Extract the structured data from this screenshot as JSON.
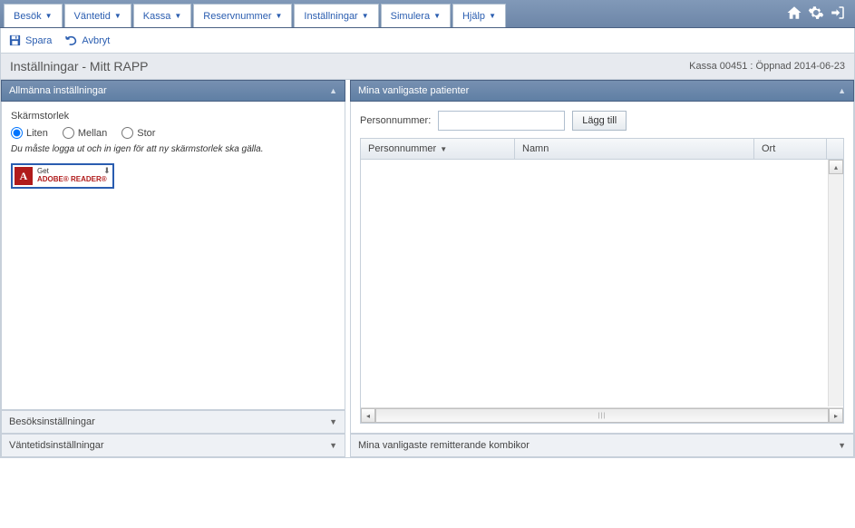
{
  "menu": [
    "Besök",
    "Väntetid",
    "Kassa",
    "Reservnummer",
    "Inställningar",
    "Simulera",
    "Hjälp"
  ],
  "toolbar": {
    "save_label": "Spara",
    "cancel_label": "Avbryt"
  },
  "page": {
    "title": "Inställningar - Mitt RAPP",
    "status": "Kassa 00451 : Öppnad 2014-06-23"
  },
  "left": {
    "general_header": "Allmänna inställningar",
    "screen_label": "Skärmstorlek",
    "size_small": "Liten",
    "size_medium": "Mellan",
    "size_large": "Stor",
    "hint": "Du måste logga ut och in igen för att ny skärmstorlek ska gälla.",
    "adobe_line1": "Get",
    "adobe_line2": "ADOBE® READER®",
    "collapsed1": "Besöksinställningar",
    "collapsed2": "Väntetidsinställningar"
  },
  "right": {
    "header": "Mina vanligaste patienter",
    "pn_label": "Personnummer:",
    "add_label": "Lägg till",
    "col_pn": "Personnummer",
    "col_name": "Namn",
    "col_ort": "Ort",
    "collapsed": "Mina vanligaste remitterande kombikor"
  }
}
